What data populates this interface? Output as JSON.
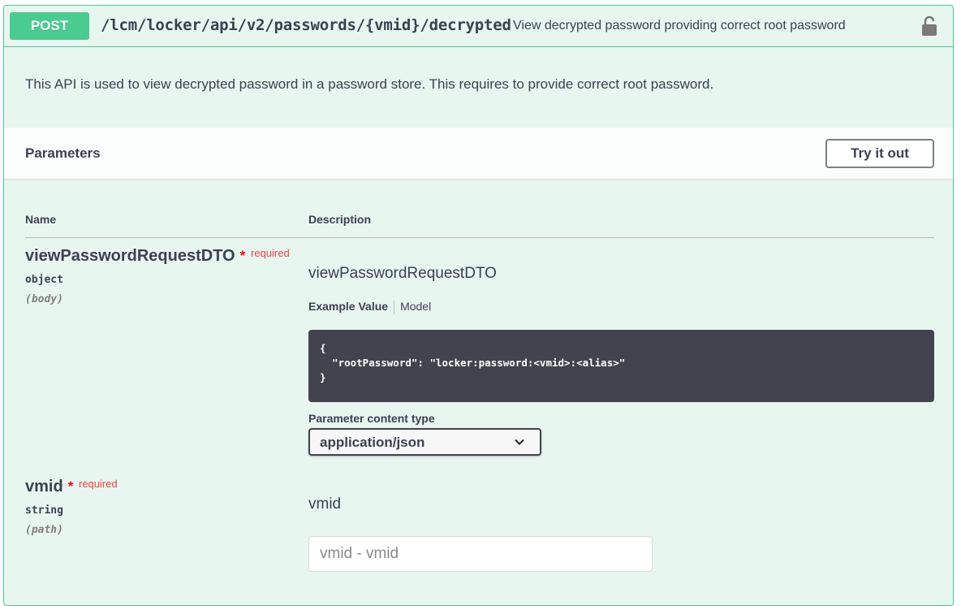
{
  "operation": {
    "method": "POST",
    "path": "/lcm/locker/api/v2/passwords/{vmid}/decrypted",
    "summary": "View decrypted password providing correct root password",
    "description": "This API is used to view decrypted password in a password store. This requires to provide correct root password.",
    "lock_icon": "unlocked-padlock-icon",
    "colors": {
      "accent": "#49cc90",
      "background": "#e8f6f0",
      "code_bg": "#41444e",
      "required": "#ff3c3c"
    }
  },
  "parameters": {
    "title": "Parameters",
    "try_label": "Try it out",
    "col_name": "Name",
    "col_description": "Description",
    "items": [
      {
        "name": "viewPasswordRequestDTO",
        "star": "*",
        "required": "required",
        "type": "object",
        "in": "(body)",
        "description": "viewPasswordRequestDTO",
        "tab_example": "Example Value",
        "tab_model": "Model",
        "example": "{\n  \"rootPassword\": \"locker:password:<vmid>:<alias>\"\n}",
        "content_type_label": "Parameter content type",
        "content_type": "application/json"
      },
      {
        "name": "vmid",
        "star": "*",
        "required": "required",
        "type": "string",
        "in": "(path)",
        "description": "vmid",
        "placeholder": "vmid - vmid",
        "value": ""
      }
    ]
  }
}
